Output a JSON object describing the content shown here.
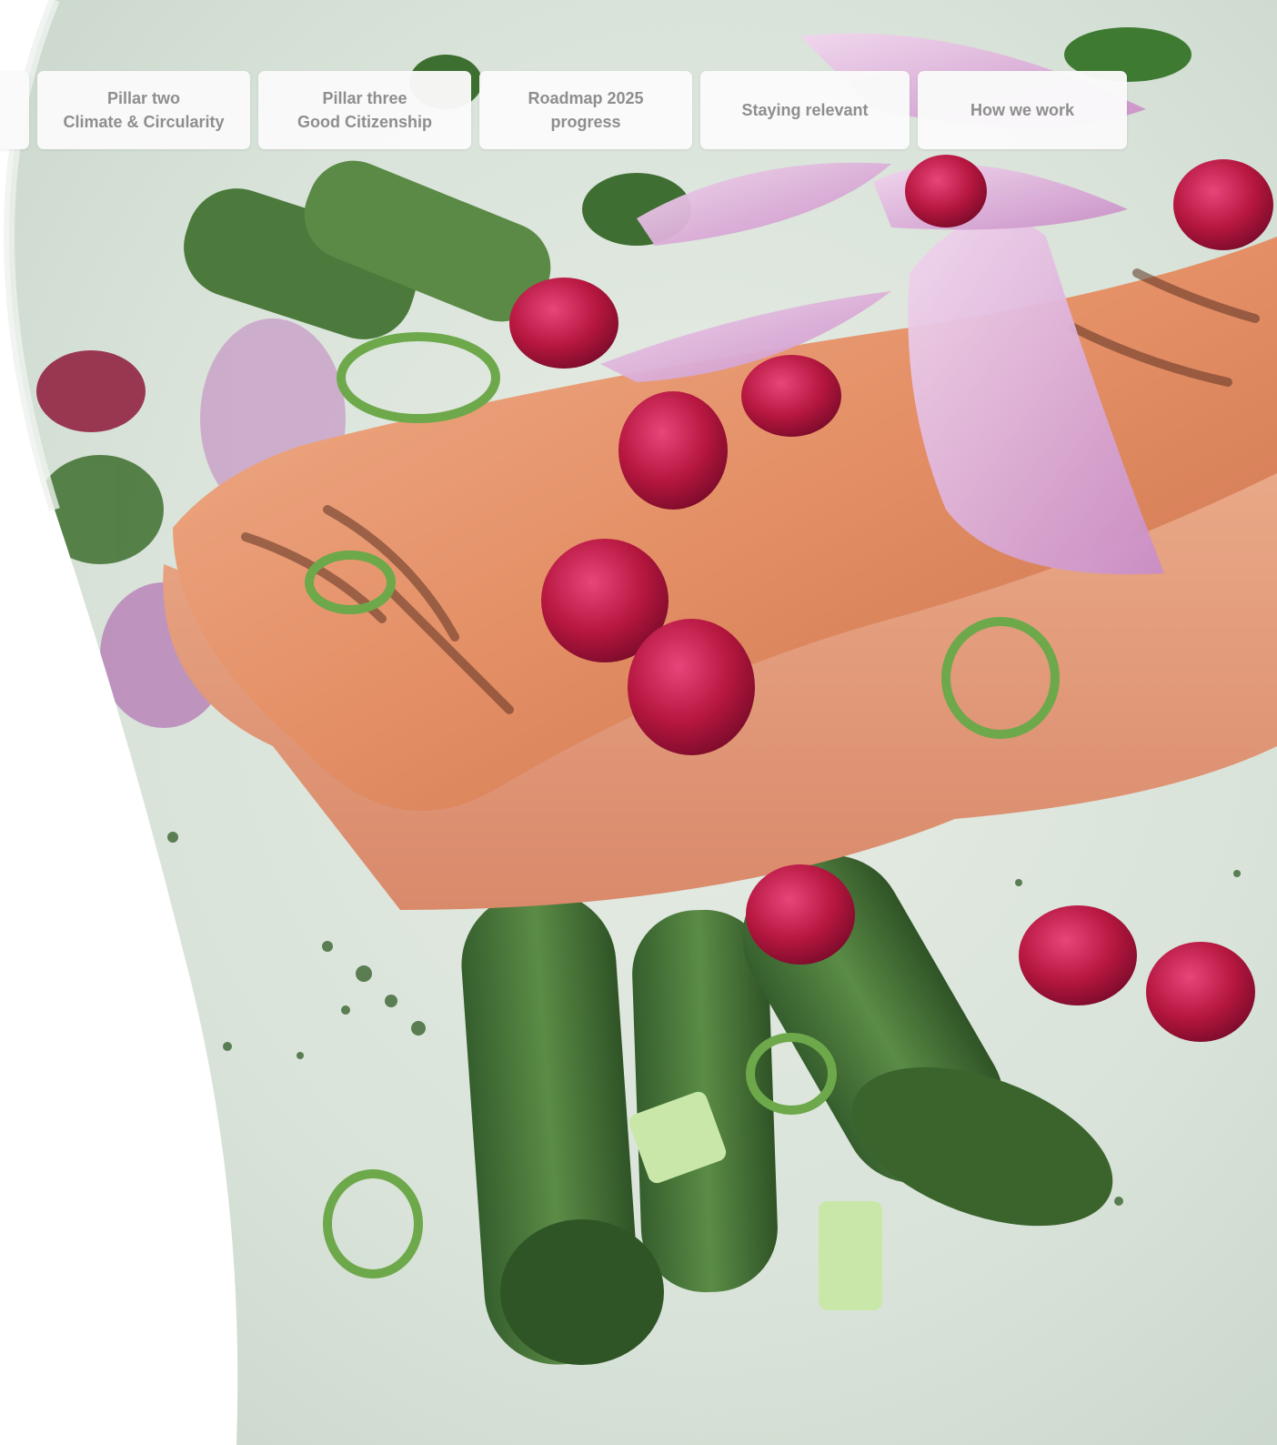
{
  "nav": {
    "tabs": [
      {
        "line1": "",
        "line2": ""
      },
      {
        "line1": "Pillar two",
        "line2": "Climate & Circularity"
      },
      {
        "line1": "Pillar three",
        "line2": "Good Citizenship"
      },
      {
        "line1": "Roadmap 2025",
        "line2": "progress"
      },
      {
        "line1": "Staying relevant",
        "line2": ""
      },
      {
        "line1": "How we work",
        "line2": ""
      }
    ]
  },
  "hero": {
    "icon": "food-photo",
    "colors": {
      "plate": "#dbe5dc",
      "salmon": "#e79a72",
      "asparagus": "#4b7a3c",
      "onion": "#d9a7d6",
      "pomegranate": "#b1123b"
    }
  }
}
